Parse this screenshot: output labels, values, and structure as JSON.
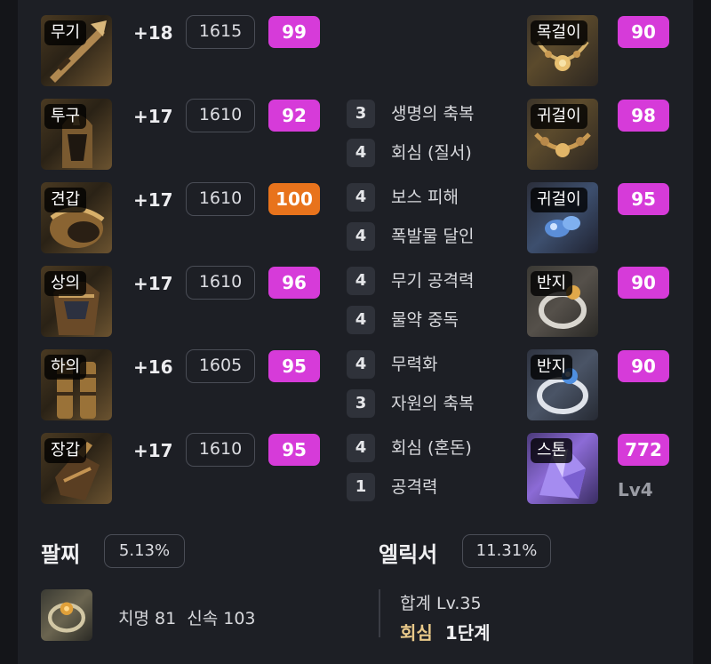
{
  "colors": {
    "quality_magenta": "#d63bd9",
    "quality_orange": "#e8731c",
    "elixir_gold": "#e9c98a"
  },
  "gear": [
    {
      "slot": "무기",
      "enhance": "+18",
      "ilvl": "1615",
      "quality": "99",
      "quality_color": "#d63bd9",
      "icon": "weapon-icon"
    },
    {
      "slot": "투구",
      "enhance": "+17",
      "ilvl": "1610",
      "quality": "92",
      "quality_color": "#d63bd9",
      "icon": "helmet-icon"
    },
    {
      "slot": "견갑",
      "enhance": "+17",
      "ilvl": "1610",
      "quality": "100",
      "quality_color": "#e8731c",
      "icon": "shoulder-icon"
    },
    {
      "slot": "상의",
      "enhance": "+17",
      "ilvl": "1610",
      "quality": "96",
      "quality_color": "#d63bd9",
      "icon": "chest-icon"
    },
    {
      "slot": "하의",
      "enhance": "+16",
      "ilvl": "1605",
      "quality": "95",
      "quality_color": "#d63bd9",
      "icon": "pants-icon"
    },
    {
      "slot": "장갑",
      "enhance": "+17",
      "ilvl": "1610",
      "quality": "95",
      "quality_color": "#d63bd9",
      "icon": "gloves-icon"
    }
  ],
  "engravings": [
    {
      "level": "3",
      "name": "생명의 축복"
    },
    {
      "level": "4",
      "name": "회심 (질서)"
    },
    {
      "level": "4",
      "name": "보스 피해"
    },
    {
      "level": "4",
      "name": "폭발물 달인"
    },
    {
      "level": "4",
      "name": "무기 공격력"
    },
    {
      "level": "4",
      "name": "물약 중독"
    },
    {
      "level": "4",
      "name": "무력화"
    },
    {
      "level": "3",
      "name": "자원의 축복"
    },
    {
      "level": "4",
      "name": "회심 (혼돈)"
    },
    {
      "level": "1",
      "name": "공격력"
    }
  ],
  "accessories": [
    {
      "slot": "목걸이",
      "quality": "90",
      "icon": "necklace-icon"
    },
    {
      "slot": "귀걸이",
      "quality": "98",
      "icon": "earring-icon"
    },
    {
      "slot": "귀걸이",
      "quality": "95",
      "icon": "earring-icon"
    },
    {
      "slot": "반지",
      "quality": "90",
      "icon": "ring-icon"
    },
    {
      "slot": "반지",
      "quality": "90",
      "icon": "ring-icon"
    }
  ],
  "stone": {
    "slot": "스톤",
    "value": "772",
    "level": "Lv4",
    "icon": "ability-stone-icon"
  },
  "bracelet": {
    "title": "팔찌",
    "percent": "5.13%",
    "stats": "치명 81  신속 103",
    "icon": "bracelet-icon"
  },
  "elixir": {
    "title": "엘릭서",
    "percent": "11.31%",
    "total": "합계 Lv.35",
    "set_name": "회심",
    "set_stage": "1단계"
  }
}
